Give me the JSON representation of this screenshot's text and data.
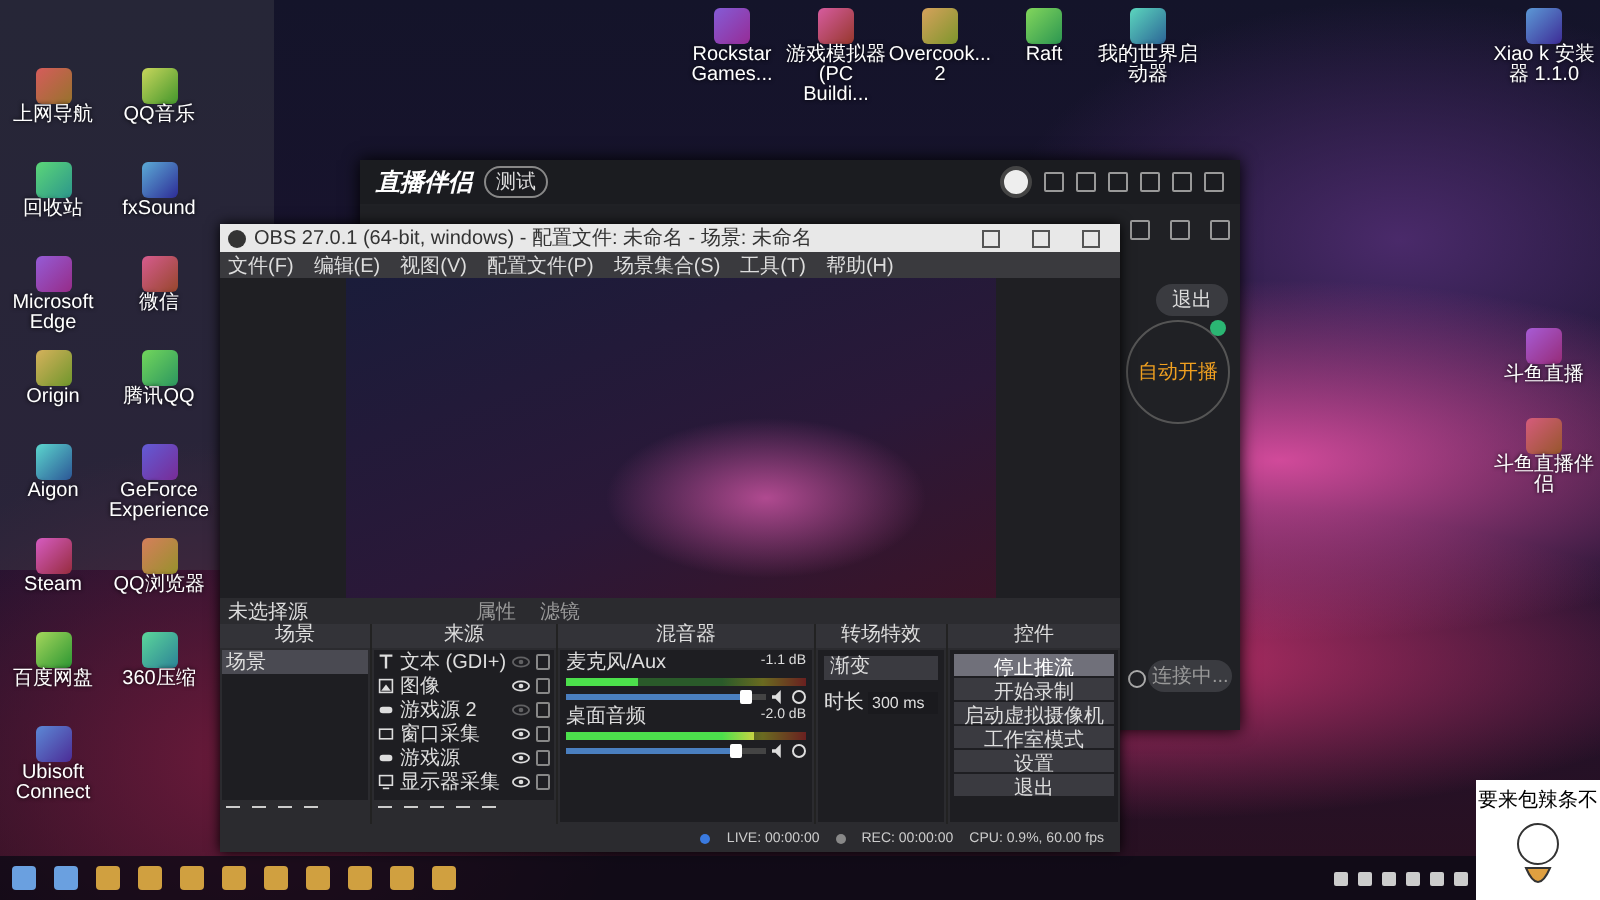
{
  "desktop": {
    "left_icons": [
      {
        "label": "上网导航"
      },
      {
        "label": "QQ音乐"
      },
      {
        "label": "回收站"
      },
      {
        "label": "fxSound"
      },
      {
        "label": "Microsoft Edge"
      },
      {
        "label": "微信"
      },
      {
        "label": "Origin"
      },
      {
        "label": "腾讯QQ"
      },
      {
        "label": "Aigon"
      },
      {
        "label": "GeForce Experience"
      },
      {
        "label": "Steam"
      },
      {
        "label": "QQ浏览器"
      },
      {
        "label": "百度网盘"
      },
      {
        "label": "360压缩"
      },
      {
        "label": "Ubisoft Connect"
      }
    ],
    "top_icons": [
      {
        "label": "Rockstar Games..."
      },
      {
        "label": "游戏模拟器 (PC Buildi..."
      },
      {
        "label": "Overcook... 2"
      },
      {
        "label": "Raft"
      },
      {
        "label": "我的世界启动器"
      }
    ],
    "right_icons": [
      {
        "label": "Xiao k 安装器 1.1.0"
      },
      {
        "label": "斗鱼直播"
      },
      {
        "label": "斗鱼直播伴侣"
      }
    ]
  },
  "live_window": {
    "logo": "直播伴侣",
    "badge": "测试",
    "exit_button": "退出",
    "auto_start": "自动开播",
    "connect_button": "连接中..."
  },
  "obs_window": {
    "title": "OBS 27.0.1 (64-bit, windows) - 配置文件: 未命名 - 场景: 未命名",
    "menu": [
      "文件(F)",
      "编辑(E)",
      "视图(V)",
      "配置文件(P)",
      "场景集合(S)",
      "工具(T)",
      "帮助(H)"
    ],
    "source_toolbar": {
      "status": "未选择源",
      "buttons": [
        "属性",
        "滤镜"
      ]
    },
    "docks": [
      "场景",
      "来源",
      "混音器",
      "转场特效",
      "控件"
    ],
    "scenes": [
      {
        "name": "场景",
        "selected": true
      }
    ],
    "sources": [
      {
        "name": "文本 (GDI+)",
        "kind": "text",
        "visible": false
      },
      {
        "name": "图像",
        "kind": "image",
        "visible": true
      },
      {
        "name": "游戏源 2",
        "kind": "game",
        "visible": false
      },
      {
        "name": "窗口采集",
        "kind": "window",
        "visible": true
      },
      {
        "name": "游戏源",
        "kind": "game",
        "visible": true
      },
      {
        "name": "显示器采集",
        "kind": "monitor",
        "visible": true
      }
    ],
    "mixer": [
      {
        "name": "麦克风/Aux",
        "reading": "-1.1 dB",
        "meter": {
          "level": 0.3
        },
        "volume": {
          "level": 0.9
        }
      },
      {
        "name": "桌面音频",
        "reading": "-2.0 dB",
        "meter": {
          "level": 0.78
        },
        "volume": {
          "level": 0.85
        }
      }
    ],
    "transition": {
      "type": "渐变",
      "duration_label": "时长",
      "duration": "300 ms"
    },
    "controls": [
      {
        "label": "停止推流",
        "active": true
      },
      {
        "label": "开始录制",
        "active": false
      },
      {
        "label": "启动虚拟摄像机",
        "active": false
      },
      {
        "label": "工作室模式",
        "active": false
      },
      {
        "label": "设置",
        "active": false
      },
      {
        "label": "退出",
        "active": false
      }
    ],
    "status": {
      "live": "LIVE: 00:00:00",
      "live_on": true,
      "rec": "REC: 00:00:00",
      "cpu": "CPU: 0.9%, 60.00 fps"
    }
  },
  "sticker": {
    "text": "要来包辣条不"
  }
}
